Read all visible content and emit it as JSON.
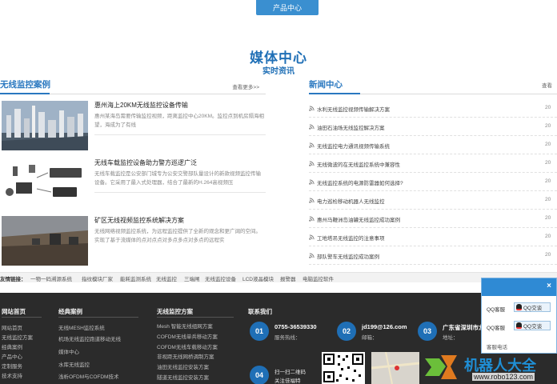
{
  "top_button": "产品中心",
  "media": {
    "title": "媒体中心",
    "subtitle": "实时资讯"
  },
  "cases": {
    "title": "无线监控案例",
    "more": "查看更多>>",
    "items": [
      {
        "title": "惠州海上20KM无线监控设备传输",
        "desc": "惠州某海岛需要传输监控视频，距离监控中心20KM。监控点到机房隔海相望，海成为了有线"
      },
      {
        "title": "无线车载监控设备助力警方巡逻广泛",
        "desc": "无线车载监控是公安部门城专为公安交警部队量设计的新款视频监控传输设备。它采用了最入式处理器，结合了最新的H.264高视频压"
      },
      {
        "title": "矿区无线视频监控系统解决方案",
        "desc": "无线网络视频监控系统，为远程监控提供了全新的观念和更广阔的空间。实现了基于流媒体的点对点点对多点多点对多点的远程实"
      }
    ]
  },
  "news": {
    "title": "新闻中心",
    "more": "查看",
    "date_prefix": "20",
    "items": [
      "水利无线监控视频传输解决方案",
      "油田石油场无线监控解决方案",
      "无线监控电力通讯视频传输系统",
      "无线微波的在无线监控系统中兼容性",
      "无线监控系统的电源防雷器如何选择?",
      "电力巡检移动机器人无线监控",
      "惠州马鞭洲岛油罐无线监控成功案例",
      "工地塔吊无线监控的注意事项",
      "部队警车无线监控成功案例"
    ]
  },
  "friend_links": {
    "label": "友情链接：",
    "items": [
      "一物一码溯源系统",
      "指纹模块厂家",
      "能耗监测系统",
      "无线监控",
      "三端闸",
      "无线监控设备",
      "LCD液晶模块",
      "报警器",
      "电脑监控软件"
    ]
  },
  "footer": {
    "col1": {
      "title": "网站首页",
      "items": [
        "网站首页",
        "无线监控方案",
        "经典案例",
        "产品中心",
        "定制服务",
        "技术支持"
      ]
    },
    "col2": {
      "title": "经典案例",
      "items": [
        "无线MESH监控系统",
        "机场无线监控跑道移动无线",
        "媒体中心",
        "水库无线监控",
        "浅析OFDM与COFDM技术"
      ]
    },
    "col3": {
      "title": "无线监控方案",
      "items": [
        "Mesh 智能无线组网方案",
        "COFDM无线单兵移动方案",
        "COFDM无线车载移动方案",
        "非视距无线网桥调制方案",
        "油田无线监控安装方案",
        "隧道无线监控安装方案"
      ]
    },
    "contact": {
      "title": "联系我们",
      "phone": "0755-36539330",
      "phone_label": "服务热线：",
      "email": "jd199@126.com",
      "email_label": "邮箱：",
      "address": "广东省深圳市龙",
      "address_label": "地址：",
      "qr_line1": "扫一扫二维码",
      "qr_line2": "关注佳福特",
      "nums": [
        "01",
        "02",
        "03",
        "04"
      ]
    }
  },
  "qq_panel": {
    "close": "×",
    "label1": "QQ客服",
    "btn1": "QQ交谈",
    "label2": "QQ客服",
    "btn2": "QQ交谈",
    "phone": "客服电话"
  },
  "watermark": {
    "text": "机器人大全",
    "url": "www.robo123.com"
  },
  "colors": {
    "accent": "#1f6fb6",
    "footer_bg": "#2b2b2b",
    "link_blue": "#2a78c0"
  }
}
